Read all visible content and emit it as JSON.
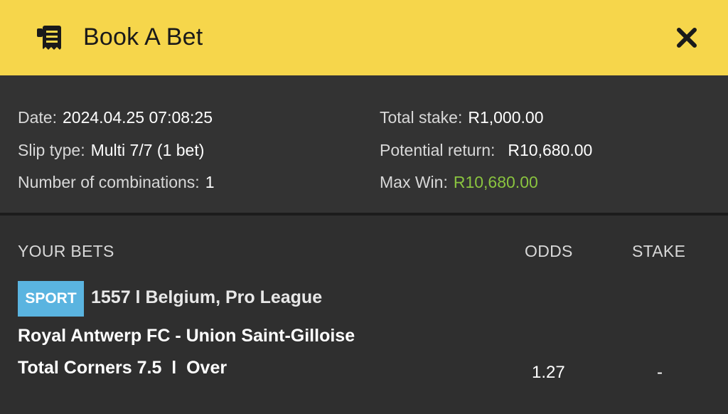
{
  "header": {
    "title": "Book A Bet",
    "icon": "receipt-icon",
    "close_icon": "close-icon",
    "background": "#f6d64b"
  },
  "summary": {
    "date_label": "Date:",
    "date_value": "2024.04.25 07:08:25",
    "slip_type_label": "Slip type:",
    "slip_type_value": "Multi 7/7 (1 bet)",
    "combinations_label": "Number of combinations:",
    "combinations_value": "1",
    "total_stake_label": "Total stake:",
    "total_stake_value": "R1,000.00",
    "potential_return_label": "Potential return:",
    "potential_return_value": "R10,680.00",
    "max_win_label": "Max Win:",
    "max_win_value": "R10,680.00",
    "max_win_color": "#8ac43f"
  },
  "bets": {
    "col_your_bets": "YOUR BETS",
    "col_odds": "ODDS",
    "col_stake": "STAKE",
    "items": [
      {
        "badge": "SPORT",
        "badge_color": "#5ab4e0",
        "event_league": "1557 l Belgium, Pro League",
        "match": "Royal Antwerp FC - Union Saint-Gilloise",
        "market": "Total Corners 7.5  l  Over",
        "odds": "1.27",
        "stake": "-"
      }
    ]
  }
}
